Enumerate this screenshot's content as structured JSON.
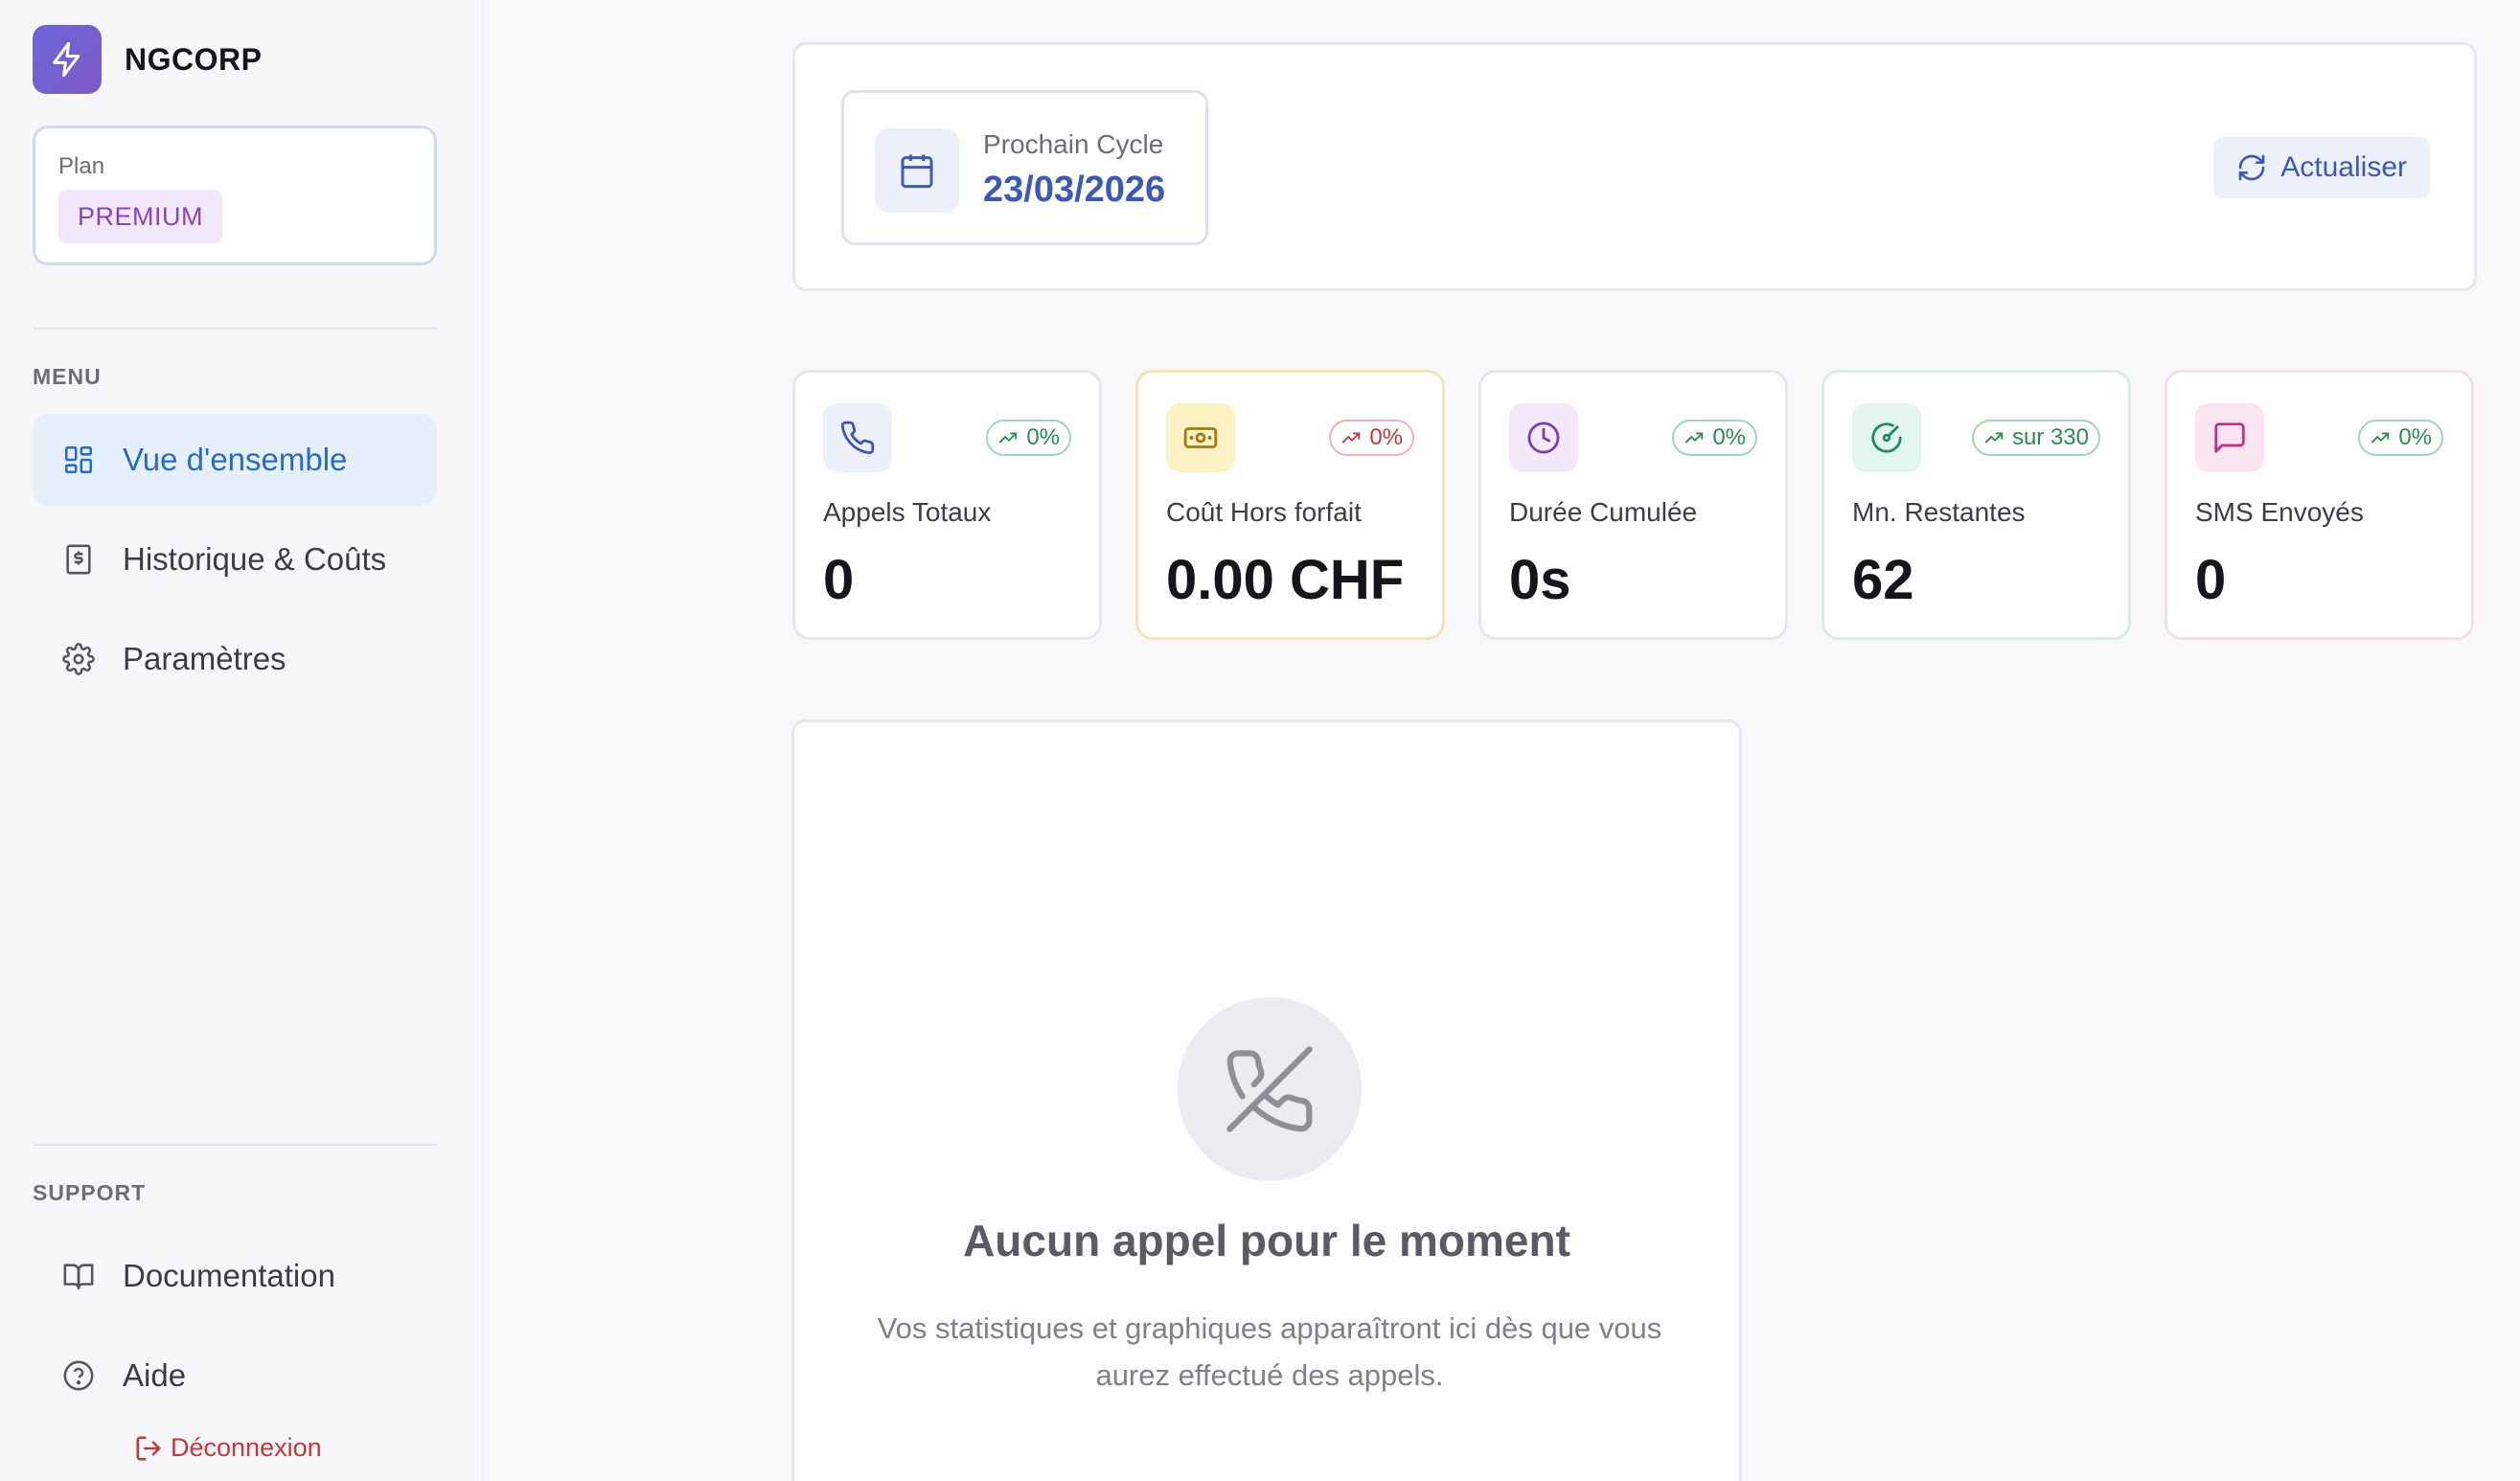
{
  "brand": {
    "name": "NGCORP"
  },
  "plan": {
    "label": "Plan",
    "value": "PREMIUM"
  },
  "menu": {
    "title": "MENU",
    "items": [
      {
        "label": "Vue d'ensemble",
        "icon": "grid-icon",
        "active": true
      },
      {
        "label": "Historique & Coûts",
        "icon": "receipt-dollar-icon",
        "active": false
      },
      {
        "label": "Paramètres",
        "icon": "gear-icon",
        "active": false
      }
    ]
  },
  "support": {
    "title": "SUPPORT",
    "items": [
      {
        "label": "Documentation",
        "icon": "book-icon"
      },
      {
        "label": "Aide",
        "icon": "help-circle-icon"
      }
    ],
    "logout_label": "Déconnexion"
  },
  "cycle": {
    "label": "Prochain Cycle",
    "date": "23/03/2026"
  },
  "refresh_label": "Actualiser",
  "stats": [
    {
      "label": "Appels Totaux",
      "value": "0",
      "badge": "0%",
      "icon": "phone-icon",
      "color": "#3c58b8",
      "trend": "up"
    },
    {
      "label": "Coût Hors forfait",
      "value": "0.00 CHF",
      "badge": "0%",
      "icon": "banknote-icon",
      "color": "#a57811",
      "trend": "up"
    },
    {
      "label": "Durée Cumulée",
      "value": "0s",
      "badge": "0%",
      "icon": "clock-icon",
      "color": "#7a3fb0",
      "trend": "up"
    },
    {
      "label": "Mn. Restantes",
      "value": "62",
      "badge": "sur 330",
      "icon": "gauge-icon",
      "color": "#1f8a6a",
      "trend": "up"
    },
    {
      "label": "SMS Envoyés",
      "value": "0",
      "badge": "0%",
      "icon": "message-icon",
      "color": "#c0327f",
      "trend": "up"
    }
  ],
  "empty_state": {
    "title": "Aucun appel pour le moment",
    "text": "Vos statistiques et graphiques apparaîtront ici dès que vous aurez effectué des appels."
  }
}
